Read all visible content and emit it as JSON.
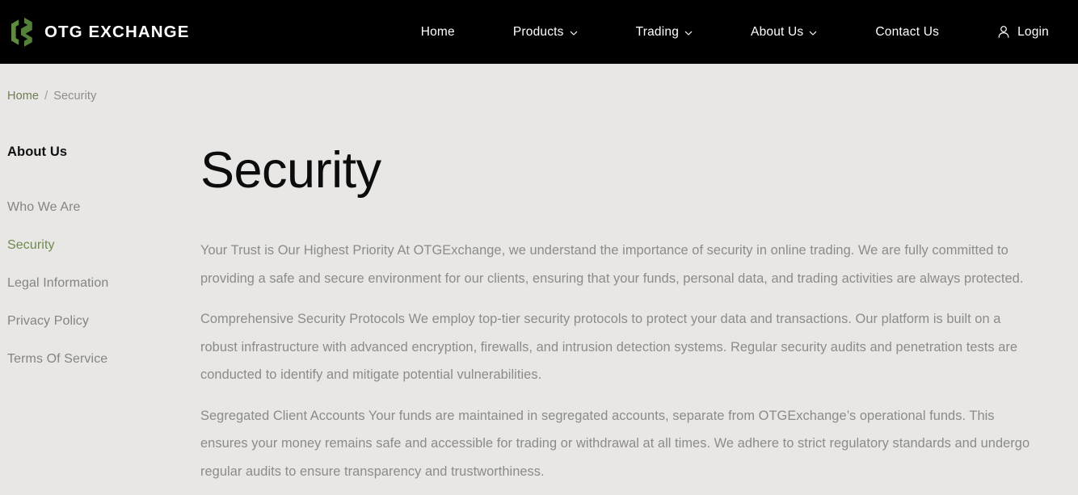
{
  "header": {
    "brand_name": "OTG EXCHANGE",
    "logo_icon": "otg-logo-mark",
    "nav": [
      {
        "label": "Home",
        "has_dropdown": false
      },
      {
        "label": "Products",
        "has_dropdown": true
      },
      {
        "label": "Trading",
        "has_dropdown": true
      },
      {
        "label": "About Us",
        "has_dropdown": true
      },
      {
        "label": "Contact Us",
        "has_dropdown": false
      }
    ],
    "login": {
      "label": "Login",
      "icon": "user-icon"
    }
  },
  "breadcrumb": {
    "home_label": "Home",
    "separator": "/",
    "current_label": "Security"
  },
  "sidebar": {
    "title": "About Us",
    "items": [
      {
        "label": "Who We Are",
        "active": false
      },
      {
        "label": "Security",
        "active": true
      },
      {
        "label": "Legal Information",
        "active": false
      },
      {
        "label": "Privacy Policy",
        "active": false
      },
      {
        "label": "Terms Of Service",
        "active": false
      }
    ]
  },
  "main": {
    "title": "Security",
    "paragraphs": [
      "Your Trust is Our Highest Priority At OTGExchange, we understand the importance of security in online trading. We are fully committed to providing a safe and secure environment for our clients, ensuring that your funds, personal data, and trading activities are always protected.",
      "Comprehensive Security Protocols We employ top-tier security protocols to protect your data and transactions. Our platform is built on a robust infrastructure with advanced encryption, firewalls, and intrusion detection systems. Regular security audits and penetration tests are conducted to identify and mitigate potential vulnerabilities.",
      "Segregated Client Accounts Your funds are maintained in segregated accounts, separate from OTGExchange’s operational funds. This ensures your money remains safe and accessible for trading or withdrawal at all times. We adhere to strict regulatory standards and undergo regular audits to ensure transparency and trustworthiness."
    ]
  },
  "colors": {
    "header_background": "#000000",
    "page_background": "#e8e7e5",
    "brand_green": "#5f8a3f",
    "accent_green": "#6f8a4e",
    "breadcrumb_link": "#6f7d52",
    "body_text": "#8b8b8a",
    "title_text": "#0c0c0c"
  }
}
